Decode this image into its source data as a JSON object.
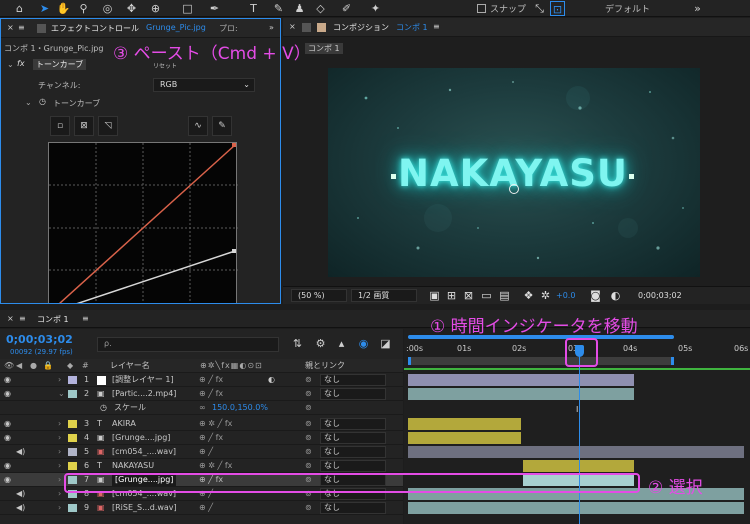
{
  "toolbar": {
    "tools": [
      "home-icon",
      "selection-icon",
      "hand-icon",
      "zoom-icon",
      "orbit-icon",
      "move-icon",
      "pan-icon",
      "rect-icon",
      "pen-icon",
      "text-icon",
      "brush-icon",
      "stamp-icon",
      "eraser-icon",
      "roto-icon",
      "pin-icon"
    ],
    "snap_label": "スナップ",
    "workspace_label": "デフォルト"
  },
  "effects_panel": {
    "tab_title": "エフェクトコントロール",
    "tab_file": "Grunge_Pic.jpg",
    "tab_other": "プロ:",
    "breadcrumb": "コンポ 1・Grunge_Pic.jpg",
    "fx_label": "fx",
    "effect_name": "トーンカーブ",
    "reset_label": "リセット",
    "channel_label": "チャンネル:",
    "channel_value": "RGB",
    "curves_label": "トーンカーブ"
  },
  "comp_panel": {
    "tab_title": "コンポジション",
    "tab_name": "コンポ 1",
    "sub_tab": "コンポ 1",
    "title_text": "NAKAYASU",
    "zoom": "(50 %)",
    "resolution": "1/2 画質",
    "exposure": "+0.0",
    "timecode": "0;00;03;02"
  },
  "timeline": {
    "tab_name": "コンポ 1",
    "timecode": "0;00;03;02",
    "frame_info": "00092 (29.97 fps)",
    "search_placeholder": "ρ.",
    "col_name": "レイヤー名",
    "col_parent": "親とリンク",
    "ruler": [
      ":00s",
      "01s",
      "02s",
      "03s",
      "04s",
      "05s",
      "06s"
    ],
    "layers": [
      {
        "num": "1",
        "type": "☐",
        "name": "[調整レイヤー 1]",
        "color": "#b3b3dd",
        "parent": "なし"
      },
      {
        "num": "2",
        "type": "▣",
        "name": "[Partic....2.mp4]",
        "color": "#9fc8c8",
        "parent": "なし"
      },
      {
        "num": "3",
        "type": "T",
        "name": "AKIRA",
        "color": "#e0d24b",
        "parent": "なし"
      },
      {
        "num": "4",
        "type": "▣",
        "name": "[Grunge....jpg]",
        "color": "#e0d24b",
        "parent": "なし"
      },
      {
        "num": "5",
        "type": "▣",
        "name": "[cm054_....wav]",
        "color": "#b0b4c7",
        "parent": "なし"
      },
      {
        "num": "6",
        "type": "T",
        "name": "NAKAYASU",
        "color": "#e0d24b",
        "parent": "なし"
      },
      {
        "num": "7",
        "type": "▣",
        "name": "[Grunge....jpg]",
        "color": "#9fc8c8",
        "parent": "なし"
      },
      {
        "num": "8",
        "type": "▣",
        "name": "[cm054_....wav]",
        "color": "#9fc8c8",
        "parent": "なし"
      },
      {
        "num": "9",
        "type": "▣",
        "name": "[RiSE_S...d.wav]",
        "color": "#9fc8c8",
        "parent": "なし"
      }
    ],
    "scale_label": "スケール",
    "scale_value": "150.0,150.0%"
  },
  "annotations": {
    "step1": "① 時間インジケータを移動",
    "step2": "② 選択",
    "step3": "③ ペースト（Cmd + V）"
  },
  "colors": {
    "accent": "#2d8ceb",
    "annotation": "#e44ce6",
    "curve_red": "#d9624a",
    "curve_white": "#d8d8d8"
  }
}
